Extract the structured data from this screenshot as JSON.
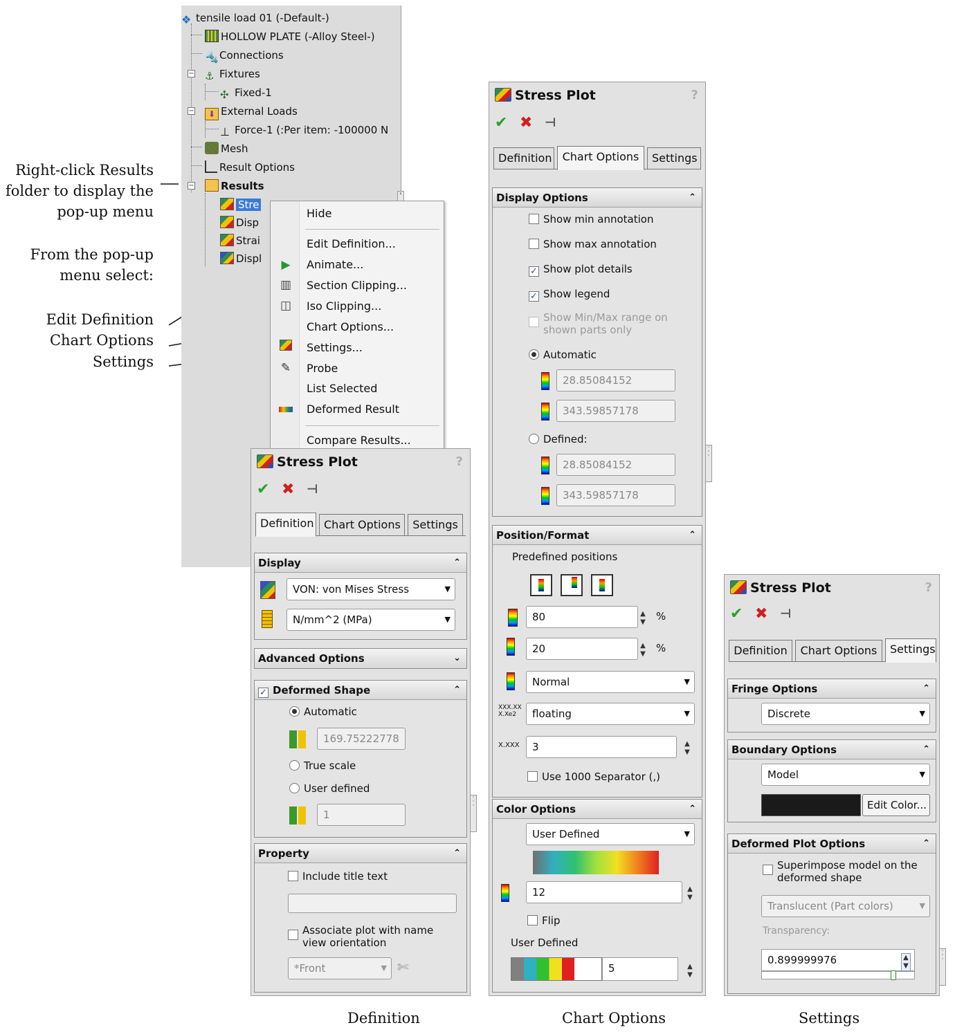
{
  "callouts": {
    "right_click": [
      "Right-click Results",
      "folder to display the",
      "pop-up menu"
    ],
    "from_menu": [
      "From the pop-up",
      "menu select:"
    ],
    "edit_def": "Edit Definition",
    "chart_opts": "Chart Options",
    "settings": "Settings"
  },
  "tree": {
    "root": "tensile load 01 (-Default-)",
    "part": "HOLLOW PLATE (-Alloy Steel-)",
    "connections": "Connections",
    "fixtures": "Fixtures",
    "fixed": "Fixed-1",
    "external_loads": "External Loads",
    "force": "Force-1 (:Per item: -100000 N",
    "mesh": "Mesh",
    "result_options": "Result Options",
    "results": "Results",
    "r1": "Stre",
    "r2": "Disp",
    "r3": "Strai",
    "r4": "Displ"
  },
  "menu": {
    "hide": "Hide",
    "edit_definition": "Edit Definition...",
    "animate": "Animate...",
    "section_clipping": "Section Clipping...",
    "iso_clipping": "Iso Clipping...",
    "chart_options": "Chart Options...",
    "settings": "Settings...",
    "probe": "Probe",
    "list_selected": "List Selected",
    "deformed_result": "Deformed Result",
    "compare_results": "Compare Results..."
  },
  "pm_common": {
    "title": "Stress Plot",
    "help": "?",
    "tab_definition": "Definition",
    "tab_chart": "Chart Options",
    "tab_settings": "Settings"
  },
  "definition": {
    "display_head": "Display",
    "component": "VON: von Mises Stress",
    "units": "N/mm^2 (MPa)",
    "advanced_head": "Advanced Options",
    "deformed_head": "Deformed Shape",
    "automatic": "Automatic",
    "auto_value": "169.75222778",
    "true_scale": "True scale",
    "user_defined": "User defined",
    "user_value": "1",
    "property_head": "Property",
    "include_title": "Include title text",
    "associate": [
      "Associate plot with name",
      "view orientation"
    ],
    "view": "*Front"
  },
  "chart": {
    "display_head": "Display Options",
    "show_min": "Show min annotation",
    "show_max": "Show max annotation",
    "show_details": "Show plot details",
    "show_legend": "Show legend",
    "show_range": [
      "Show Min/Max range on",
      "shown parts only"
    ],
    "automatic": "Automatic",
    "auto_min": "28.85084152",
    "auto_max": "343.59857178",
    "defined": "Defined:",
    "def_min": "28.85084152",
    "def_max": "343.59857178",
    "pos_head": "Position/Format",
    "predefined": "Predefined positions",
    "width": "80",
    "height": "20",
    "pct": "%",
    "orientation": "Normal",
    "number_format": "floating",
    "fmt_icon_top": "XXX.XX",
    "fmt_icon_bot": "X.Xe2",
    "dec_icon": "X.XXX",
    "decimals": "3",
    "separator": "Use 1000 Separator (,)",
    "color_head": "Color Options",
    "color_scheme": "User Defined",
    "num_colors": "12",
    "flip": "Flip",
    "user_defined": "User Defined",
    "user_count": "5"
  },
  "settings": {
    "fringe_head": "Fringe Options",
    "fringe": "Discrete",
    "boundary_head": "Boundary Options",
    "boundary": "Model",
    "edit_color": "Edit Color...",
    "deformed_head": "Deformed Plot Options",
    "superimpose": [
      "Superimpose model on the",
      "deformed shape"
    ],
    "translucent": "Translucent (Part colors)",
    "transparency_label": "Transparency:",
    "transparency": "0.899999976"
  },
  "captions": {
    "definition": "Definition",
    "chart": "Chart Options",
    "settings": "Settings"
  }
}
